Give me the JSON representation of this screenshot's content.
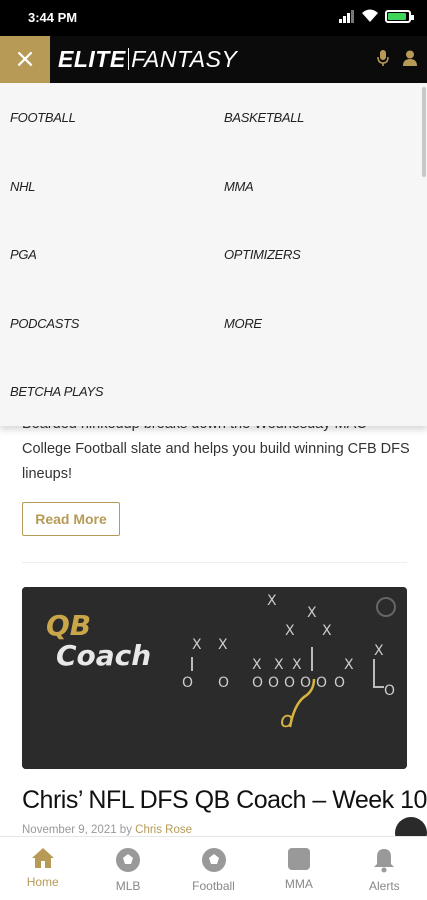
{
  "status_bar": {
    "time": "3:44 PM"
  },
  "header": {
    "close_label": "×",
    "logo_left": "ELITE",
    "logo_right": "FANTASY"
  },
  "menu": {
    "items": [
      "FOOTBALL",
      "BASKETBALL",
      "NHL",
      "MMA",
      "PGA",
      "OPTIMIZERS",
      "PODCASTS",
      "MORE",
      "BETCHA PLAYS"
    ]
  },
  "article_prev": {
    "text": "Bearded hinkedup breaks down the Wednesday MAC College Football slate and helps you build winning CFB DFS lineups!",
    "read_more": "Read More"
  },
  "article": {
    "hero_line1": "QB",
    "hero_line2": "Coach",
    "title": "Chris’ NFL DFS QB Coach – Week 10",
    "date": "November 9, 2021 by",
    "author": "Chris Rose"
  },
  "bottom_nav": {
    "items": [
      "Home",
      "MLB",
      "Football",
      "MMA",
      "Alerts"
    ],
    "active": "Home"
  },
  "colors": {
    "gold": "#b69a56",
    "dark": "#0b0b0b"
  }
}
